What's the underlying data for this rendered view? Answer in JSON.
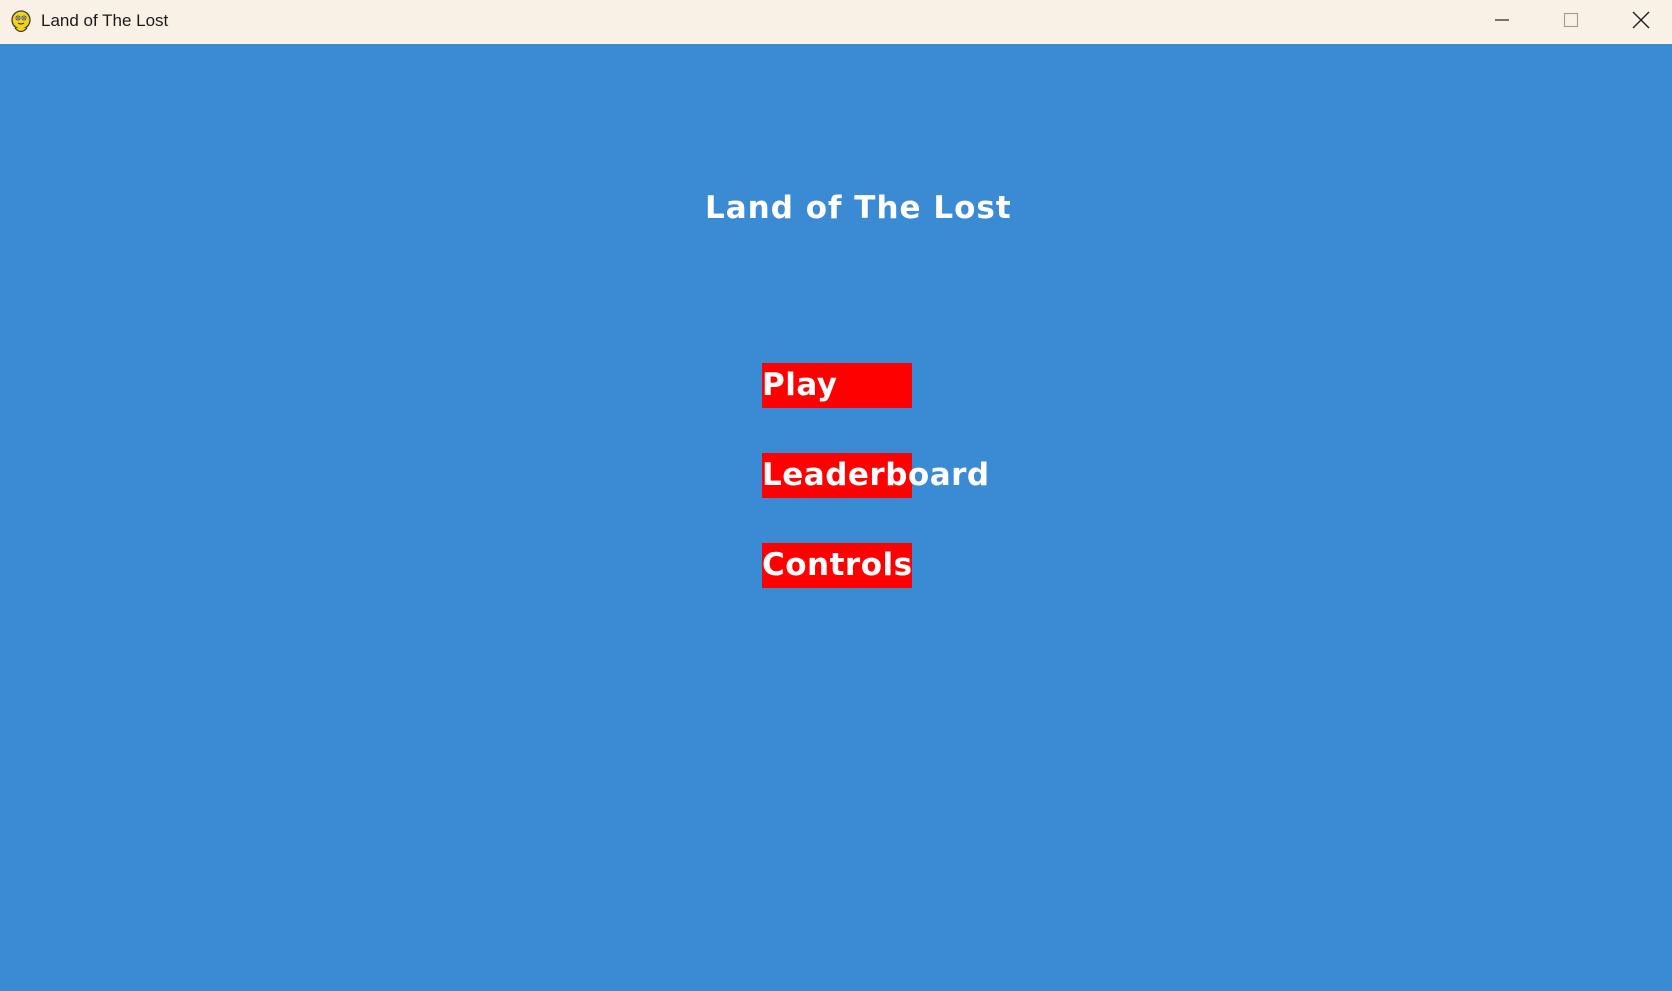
{
  "window": {
    "title": "Land of The Lost",
    "icon": "pygame-snake-icon",
    "controls": {
      "minimize_icon": "minimize-icon",
      "maximize_icon": "maximize-icon",
      "close_icon": "close-icon"
    }
  },
  "game": {
    "title": "Land of The Lost",
    "menu": [
      {
        "label": "Play"
      },
      {
        "label": "Leaderboard"
      },
      {
        "label": "Controls"
      }
    ]
  },
  "colors": {
    "background": "#3a8ad4",
    "button": "#ff0000",
    "text": "#ffffff",
    "titlebar": "#faf1e6"
  }
}
